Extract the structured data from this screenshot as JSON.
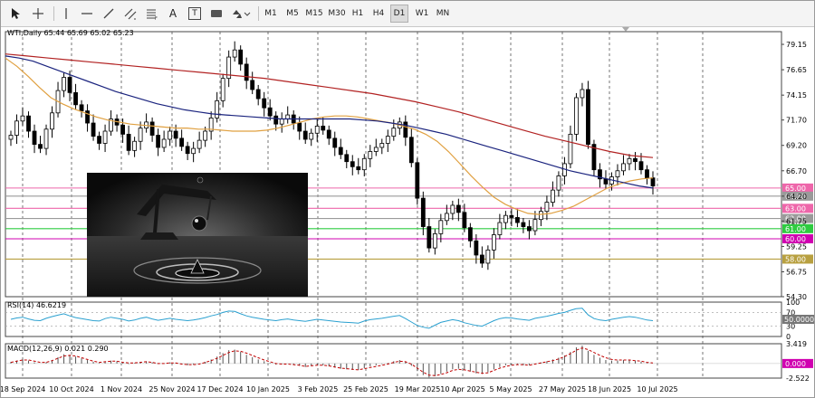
{
  "toolbar": {
    "tools": [
      {
        "name": "cursor-icon"
      },
      {
        "name": "crosshair-icon"
      },
      {
        "name": "vertical-line-icon"
      },
      {
        "name": "horizontal-line-icon"
      },
      {
        "name": "trendline-icon"
      },
      {
        "name": "equidistant-channel-icon"
      },
      {
        "name": "fibonacci-icon"
      },
      {
        "name": "text-icon"
      },
      {
        "name": "text-label-icon"
      },
      {
        "name": "rectangle-icon"
      },
      {
        "name": "shapes-dropdown-icon"
      }
    ],
    "text_tool_label": "A",
    "text_label_tool_label": "T",
    "timeframes": [
      {
        "label": "M1"
      },
      {
        "label": "M5"
      },
      {
        "label": "M15"
      },
      {
        "label": "M30"
      },
      {
        "label": "H1"
      },
      {
        "label": "H4"
      },
      {
        "label": "D1"
      },
      {
        "label": "W1"
      },
      {
        "label": "MN"
      }
    ],
    "active_timeframe": "D1"
  },
  "chart_header": {
    "symbol_line": "WTI,Daily  65.44 65.69 65.02 65.23"
  },
  "colors": {
    "candle": "#000000",
    "ma_fast": "#e0a040",
    "ma_mid": "#1a237e",
    "ma_slow": "#b22222",
    "level_pink": "#ee66aa",
    "level_magenta": "#d000b0",
    "level_green": "#2ecc40",
    "level_olive": "#b8a040",
    "level_gray": "#9a9a9a",
    "rsi_line": "#2aa0d0",
    "macd_hist": "#555555",
    "macd_signal": "#c00000"
  },
  "chart_data": [
    {
      "type": "candlestick",
      "title": "WTI,Daily",
      "ohlc_last": {
        "open": 65.44,
        "high": 65.69,
        "low": 65.02,
        "close": 65.23
      },
      "ylim": [
        54.3,
        80.4
      ],
      "y_ticks": [
        "79.15",
        "76.65",
        "74.15",
        "71.70",
        "69.20",
        "66.70",
        "64.20",
        "61.75",
        "59.25",
        "56.75",
        "54.30"
      ],
      "x_ticks": [
        "18 Sep 2024",
        "10 Oct 2024",
        "1 Nov 2024",
        "25 Nov 2024",
        "17 Dec 2024",
        "10 Jan 2025",
        "3 Feb 2025",
        "25 Feb 2025",
        "19 Mar 2025",
        "10 Apr 2025",
        "5 May 2025",
        "27 May 2025",
        "18 Jun 2025",
        "10 Jul 2025"
      ],
      "close_series": [
        70.2,
        71.6,
        72.1,
        70.6,
        69.3,
        68.9,
        70.8,
        72.4,
        74.6,
        75.9,
        74.4,
        73.2,
        72.6,
        71.4,
        70.1,
        69.4,
        70.6,
        71.8,
        71.2,
        70.3,
        68.7,
        69.6,
        70.9,
        71.5,
        70.2,
        69.0,
        69.8,
        70.6,
        69.9,
        69.1,
        68.4,
        68.9,
        69.7,
        70.6,
        71.9,
        73.6,
        75.8,
        77.9,
        78.6,
        77.2,
        75.6,
        74.7,
        73.8,
        72.9,
        72.1,
        71.3,
        71.8,
        72.2,
        71.4,
        70.6,
        69.8,
        70.4,
        71.1,
        70.7,
        69.9,
        69.0,
        68.3,
        67.6,
        67.1,
        66.8,
        67.9,
        68.6,
        69.0,
        69.4,
        70.1,
        70.9,
        71.5,
        70.0,
        67.5,
        64.0,
        61.2,
        59.1,
        60.5,
        61.8,
        62.5,
        63.3,
        62.6,
        61.1,
        59.8,
        58.4,
        57.6,
        58.9,
        60.4,
        61.6,
        62.3,
        62.1,
        61.6,
        61.2,
        60.8,
        61.9,
        62.7,
        63.6,
        64.8,
        66.2,
        67.4,
        70.3,
        73.9,
        74.7,
        69.3,
        66.8,
        65.9,
        65.4,
        66.1,
        66.7,
        67.4,
        67.9,
        67.6,
        66.8,
        66.0,
        65.2
      ],
      "lines": [
        {
          "kind": "moving-average",
          "color_key": "ma_fast",
          "values": [
            77.8,
            77.0,
            76.0,
            74.9,
            73.9,
            73.3,
            72.8,
            72.4,
            72.0,
            71.7,
            71.5,
            71.3,
            71.2,
            71.1,
            71.0,
            70.9,
            70.9,
            70.8,
            70.8,
            70.7,
            70.6,
            70.6,
            70.6,
            70.7,
            70.9,
            71.2,
            71.5,
            71.8,
            72.0,
            72.1,
            72.1,
            72.0,
            71.8,
            71.6,
            71.4,
            71.1,
            70.8,
            70.3,
            69.6,
            68.6,
            67.4,
            66.2,
            65.1,
            64.1,
            63.4,
            62.9,
            62.5,
            62.4,
            62.5,
            62.8,
            63.2,
            63.8,
            64.4,
            65.0,
            65.4,
            65.7,
            65.9,
            66.0
          ]
        },
        {
          "kind": "moving-average",
          "color_key": "ma_mid",
          "values": [
            78.0,
            77.8,
            77.5,
            77.0,
            76.5,
            76.0,
            75.5,
            75.0,
            74.5,
            74.1,
            73.7,
            73.3,
            73.0,
            72.7,
            72.5,
            72.3,
            72.2,
            72.1,
            72.0,
            71.9,
            71.8,
            71.8,
            71.8,
            71.8,
            71.8,
            71.8,
            71.7,
            71.6,
            71.4,
            71.2,
            70.9,
            70.6,
            70.3,
            69.9,
            69.5,
            69.1,
            68.7,
            68.3,
            67.9,
            67.5,
            67.1,
            66.7,
            66.4,
            66.1,
            65.8,
            65.5,
            65.2,
            65.0
          ]
        },
        {
          "kind": "moving-average",
          "color_key": "ma_slow",
          "values": [
            78.2,
            78.0,
            77.8,
            77.6,
            77.4,
            77.2,
            77.0,
            76.8,
            76.6,
            76.4,
            76.2,
            76.0,
            75.8,
            75.5,
            75.2,
            74.9,
            74.6,
            74.3,
            73.9,
            73.5,
            73.0,
            72.5,
            71.9,
            71.3,
            70.7,
            70.1,
            69.6,
            69.1,
            68.6,
            68.2,
            68.0
          ]
        }
      ],
      "levels": [
        {
          "label": "65.00",
          "color_key": "level_pink"
        },
        {
          "label": "64.20",
          "color_key": "level_gray"
        },
        {
          "label": "63.00",
          "color_key": "level_pink"
        },
        {
          "label": "62.00",
          "color_key": "level_gray"
        },
        {
          "label": "61.00",
          "color_key": "level_green"
        },
        {
          "label": "60.00",
          "color_key": "level_magenta"
        },
        {
          "label": "58.00",
          "color_key": "level_olive"
        }
      ]
    },
    {
      "type": "line",
      "title": "RSI(14) 46.6219",
      "ylim": [
        0,
        100
      ],
      "y_ticks": [
        "100",
        "70",
        "30",
        "0"
      ],
      "current_label": "50.0000",
      "values": [
        50,
        54,
        56,
        51,
        47,
        46,
        53,
        58,
        62,
        66,
        60,
        55,
        52,
        49,
        46,
        45,
        52,
        56,
        53,
        50,
        45,
        48,
        53,
        56,
        51,
        47,
        50,
        53,
        50,
        48,
        46,
        48,
        51,
        55,
        60,
        64,
        70,
        74,
        73,
        66,
        60,
        56,
        53,
        50,
        48,
        46,
        49,
        51,
        48,
        46,
        44,
        47,
        50,
        48,
        46,
        44,
        42,
        41,
        40,
        39,
        45,
        49,
        51,
        53,
        56,
        59,
        61,
        52,
        42,
        32,
        27,
        24,
        33,
        41,
        45,
        49,
        46,
        40,
        36,
        32,
        30,
        38,
        46,
        52,
        55,
        54,
        51,
        49,
        47,
        53,
        56,
        59,
        63,
        67,
        70,
        76,
        81,
        82,
        63,
        52,
        48,
        46,
        50,
        53,
        56,
        58,
        56,
        52,
        48,
        46
      ]
    },
    {
      "type": "bar",
      "title": "MACD(12,26,9) 0.021 0.290",
      "ylim": [
        -2.522,
        3.419
      ],
      "y_ticks": [
        "3.419",
        "0.000",
        "-2.522"
      ],
      "current_label": "0.000",
      "histogram": [
        0.3,
        0.5,
        0.7,
        0.5,
        0.2,
        0.0,
        0.2,
        0.6,
        1.1,
        1.6,
        1.5,
        1.2,
        0.9,
        0.6,
        0.3,
        0.1,
        0.3,
        0.5,
        0.4,
        0.2,
        -0.1,
        0.1,
        0.3,
        0.4,
        0.2,
        -0.1,
        0.0,
        0.2,
        0.1,
        -0.1,
        -0.3,
        -0.2,
        0.0,
        0.3,
        0.7,
        1.2,
        1.8,
        2.3,
        2.4,
        2.0,
        1.5,
        1.1,
        0.7,
        0.4,
        0.1,
        -0.2,
        -0.1,
        0.0,
        -0.2,
        -0.4,
        -0.6,
        -0.4,
        -0.2,
        -0.3,
        -0.5,
        -0.7,
        -0.9,
        -1.0,
        -1.1,
        -1.1,
        -0.8,
        -0.5,
        -0.3,
        -0.1,
        0.1,
        0.4,
        0.6,
        0.3,
        -0.4,
        -1.3,
        -2.0,
        -2.4,
        -2.2,
        -1.8,
        -1.4,
        -1.0,
        -0.9,
        -1.1,
        -1.4,
        -1.7,
        -1.8,
        -1.5,
        -1.0,
        -0.6,
        -0.3,
        -0.2,
        -0.2,
        -0.3,
        -0.3,
        0.0,
        0.2,
        0.4,
        0.7,
        1.0,
        1.4,
        2.0,
        2.8,
        3.1,
        2.2,
        1.5,
        1.0,
        0.6,
        0.5,
        0.5,
        0.6,
        0.6,
        0.5,
        0.3,
        0.1,
        0.0
      ],
      "signal": [
        0.2,
        0.4,
        0.6,
        0.6,
        0.4,
        0.2,
        0.2,
        0.5,
        0.9,
        1.3,
        1.4,
        1.3,
        1.0,
        0.7,
        0.4,
        0.2,
        0.3,
        0.4,
        0.4,
        0.2,
        0.1,
        0.1,
        0.2,
        0.3,
        0.2,
        0.0,
        0.0,
        0.1,
        0.1,
        -0.1,
        -0.2,
        -0.2,
        -0.1,
        0.2,
        0.5,
        0.9,
        1.4,
        1.9,
        2.2,
        2.1,
        1.8,
        1.4,
        1.0,
        0.6,
        0.3,
        0.0,
        -0.1,
        -0.1,
        -0.2,
        -0.3,
        -0.5,
        -0.4,
        -0.3,
        -0.3,
        -0.4,
        -0.6,
        -0.8,
        -0.9,
        -1.0,
        -1.1,
        -0.9,
        -0.7,
        -0.5,
        -0.3,
        -0.1,
        0.2,
        0.4,
        0.3,
        -0.1,
        -0.8,
        -1.5,
        -2.0,
        -2.1,
        -1.9,
        -1.6,
        -1.2,
        -1.0,
        -1.1,
        -1.3,
        -1.5,
        -1.7,
        -1.6,
        -1.2,
        -0.8,
        -0.5,
        -0.3,
        -0.2,
        -0.2,
        -0.3,
        -0.1,
        0.1,
        0.3,
        0.5,
        0.8,
        1.2,
        1.7,
        2.3,
        2.7,
        2.4,
        1.9,
        1.4,
        1.0,
        0.7,
        0.6,
        0.6,
        0.6,
        0.5,
        0.4,
        0.2,
        0.1
      ]
    }
  ]
}
